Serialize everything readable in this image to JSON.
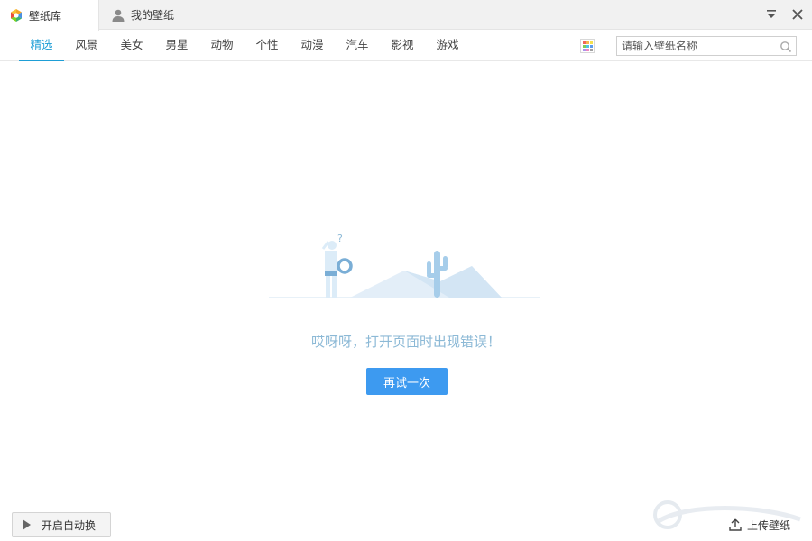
{
  "titlebar": {
    "tabs": [
      {
        "label": "壁纸库",
        "icon": "wallpaper-logo-icon",
        "active": true
      },
      {
        "label": "我的壁纸",
        "icon": "user-icon",
        "active": false
      }
    ],
    "menu_icon": "dropdown-menu-icon",
    "close_icon": "close-icon"
  },
  "categories": [
    {
      "label": "精选",
      "active": true
    },
    {
      "label": "风景"
    },
    {
      "label": "美女"
    },
    {
      "label": "男星"
    },
    {
      "label": "动物"
    },
    {
      "label": "个性"
    },
    {
      "label": "动漫"
    },
    {
      "label": "汽车"
    },
    {
      "label": "影视"
    },
    {
      "label": "游戏"
    }
  ],
  "search": {
    "placeholder": "请输入壁纸名称",
    "value": "",
    "icon": "search-icon"
  },
  "grid_icon": "color-grid-icon",
  "error": {
    "message": "哎呀呀，打开页面时出现错误！",
    "retry_label": "再试一次",
    "illustration": "confused-person-desert-cactus"
  },
  "footer": {
    "auto_switch_label": "开启自动换",
    "upload_label": "上传壁纸"
  },
  "colors": {
    "accent": "#1e9ed6",
    "button": "#3d9af0",
    "error_text": "#8cb9d6"
  }
}
